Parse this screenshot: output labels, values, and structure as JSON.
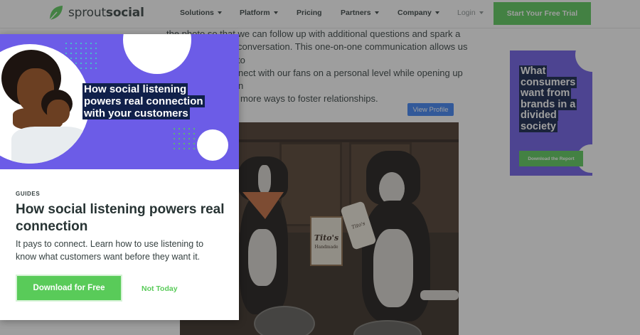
{
  "brand": {
    "name_regular": "sprout",
    "name_bold": "social",
    "accent_color": "#59cb59",
    "purple_color": "#6c5ce7",
    "navy_color": "#10204a"
  },
  "nav": {
    "items": [
      {
        "label": "Solutions",
        "has_caret": true
      },
      {
        "label": "Platform",
        "has_caret": true
      },
      {
        "label": "Pricing",
        "has_caret": false
      },
      {
        "label": "Partners",
        "has_caret": true
      },
      {
        "label": "Company",
        "has_caret": true
      },
      {
        "label": "Login",
        "has_caret": true
      }
    ],
    "cta_label": "Start Your Free Trial"
  },
  "article": {
    "lines": [
      "the photo so that we can follow up with additional questions and spark a",
      "conversation. This one-on-one communication allows us to",
      "connect with our fans on a personal level while opening up even",
      "more ways to foster relationships."
    ],
    "view_profile_label": "View Profile",
    "photo": {
      "sign_title": "Tito's",
      "sign_sub": "Handmade",
      "bottle_label": "Tito's"
    }
  },
  "side_ad": {
    "heading": "What consumers want from brands in a divided society",
    "button_label": "Download the Report"
  },
  "modal": {
    "banner_heading": "How social listening powers real connection with your customers",
    "kicker": "GUIDES",
    "title": "How social listening powers real connection",
    "description": "It pays to connect. Learn how to use listening to know what customers want before they want it.",
    "primary_label": "Download for Free",
    "secondary_label": "Not Today"
  },
  "icons": {
    "logo": "sprout-leaf-icon",
    "nav_caret": "caret-down-icon"
  }
}
